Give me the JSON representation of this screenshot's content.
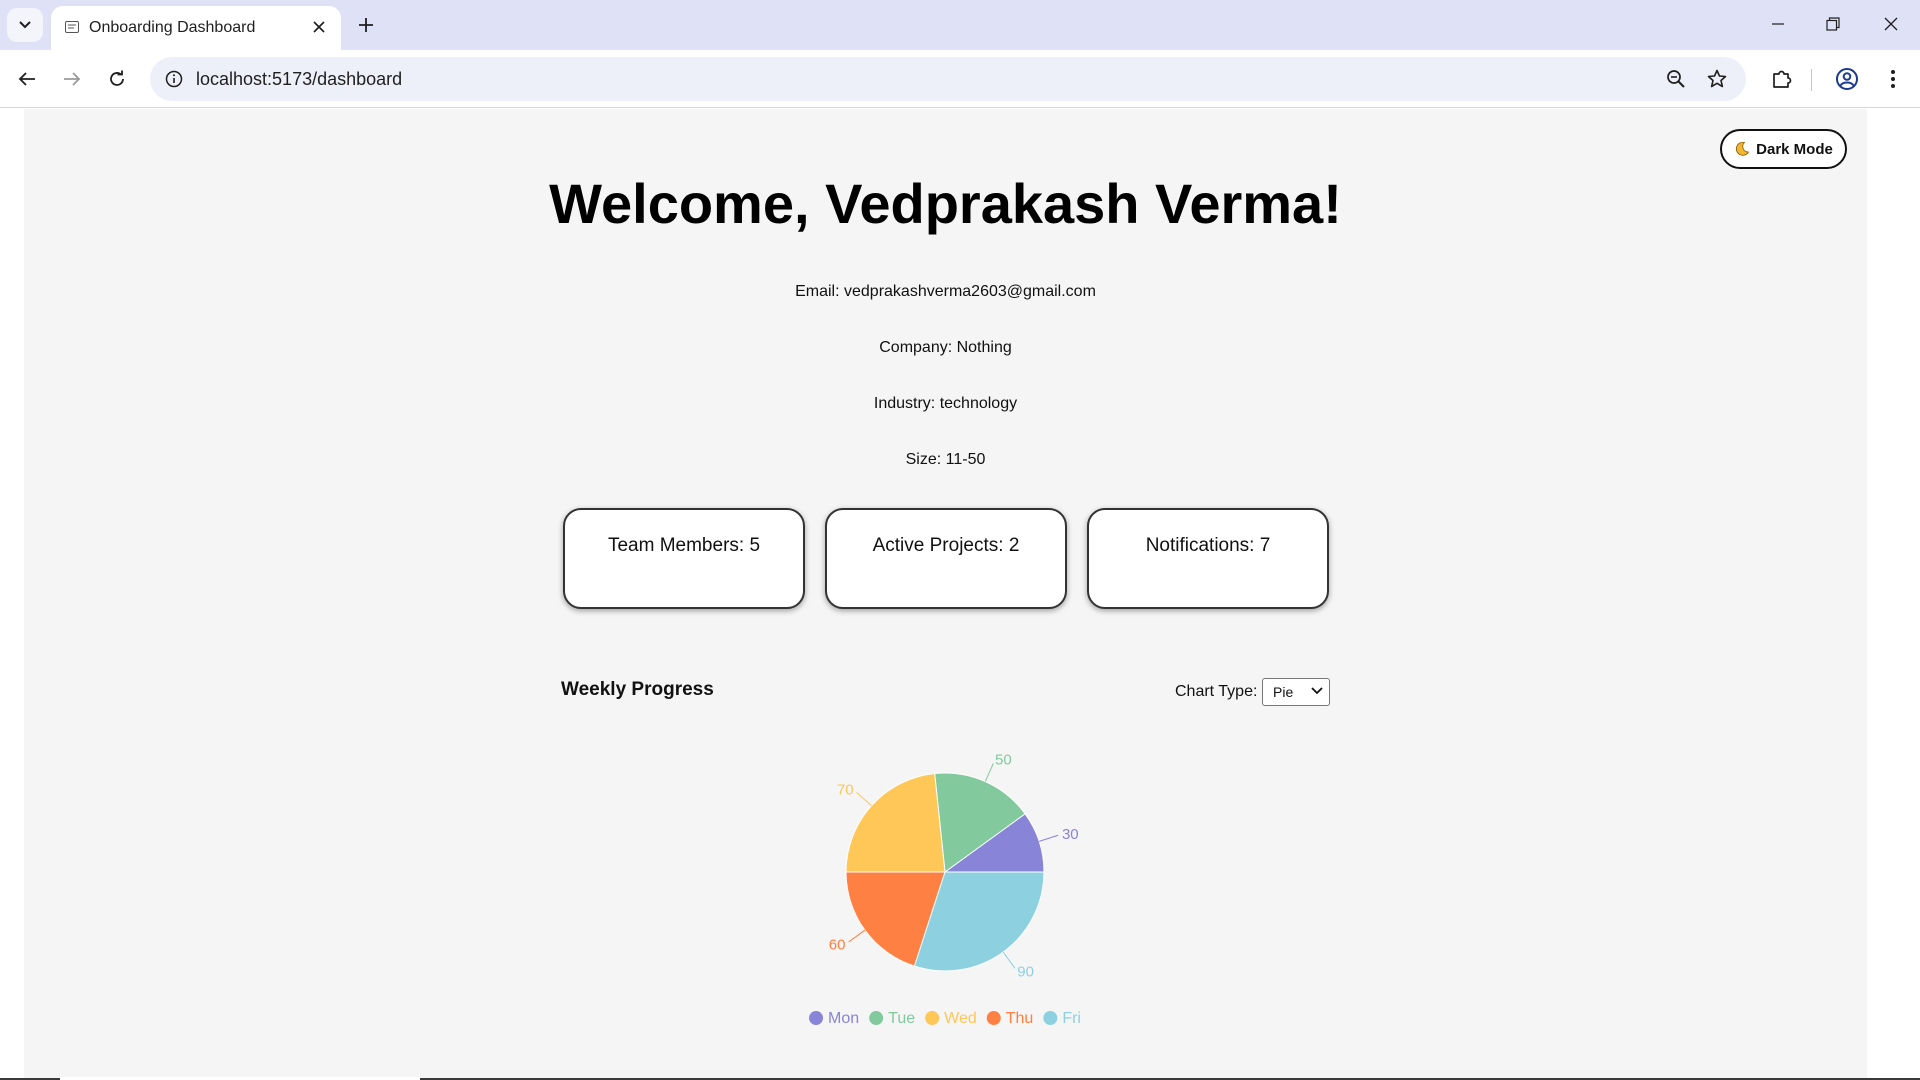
{
  "browser": {
    "tab_title": "Onboarding Dashboard",
    "url": "localhost:5173/dashboard"
  },
  "page": {
    "dark_mode_label": "Dark Mode",
    "dark_mode_icon": "moon-icon",
    "welcome": "Welcome, Vedprakash Verma!",
    "info": {
      "email": "Email: vedprakashverma2603@gmail.com",
      "company": "Company: Nothing",
      "industry": "Industry: technology",
      "size": "Size: 11-50"
    },
    "cards": [
      {
        "label": "Team Members: 5"
      },
      {
        "label": "Active Projects: 2"
      },
      {
        "label": "Notifications: 7"
      }
    ],
    "chart_section": {
      "title": "Weekly Progress",
      "type_label": "Chart Type:",
      "type_selected": "Pie"
    }
  },
  "chart_data": {
    "type": "pie",
    "title": "",
    "categories": [
      "Mon",
      "Tue",
      "Wed",
      "Thu",
      "Fri"
    ],
    "values": [
      30,
      50,
      70,
      60,
      90
    ],
    "colors": [
      "#8884d8",
      "#82ca9d",
      "#ffc658",
      "#ff8042",
      "#8dd1e1"
    ],
    "data_labels": true,
    "legend": "bottom"
  }
}
